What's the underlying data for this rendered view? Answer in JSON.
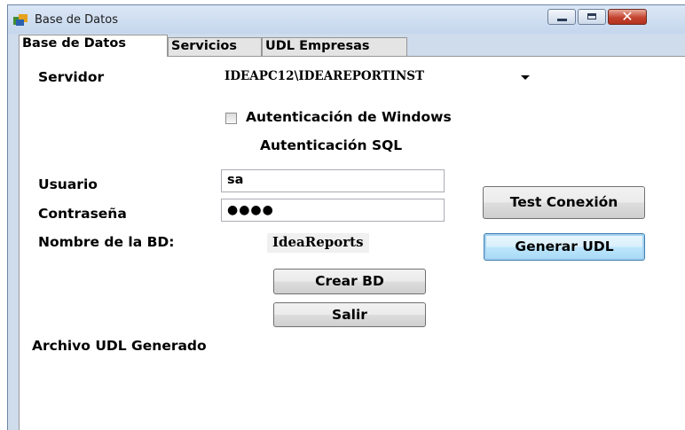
{
  "window": {
    "title": "Base de Datos",
    "close_glyph": "✕"
  },
  "tabs": [
    {
      "label": "Base de Datos",
      "active": true
    },
    {
      "label": "Servicios",
      "active": false
    },
    {
      "label": "UDL Empresas",
      "active": false
    }
  ],
  "form": {
    "servidor_label": "Servidor",
    "servidor_value": "IDEAPC12\\IDEAREPORTINST",
    "windows_auth_label": "Autenticación de Windows",
    "windows_auth_checked": false,
    "sql_auth_label": "Autenticación SQL",
    "usuario_label": "Usuario",
    "usuario_value": "sa",
    "password_label": "Contraseña",
    "password_value": "●●●●",
    "dbname_label": "Nombre de la BD:",
    "dbname_value": "IdeaReports",
    "udl_generated_label": "Archivo UDL Generado"
  },
  "buttons": {
    "test_connection": "Test Conexión",
    "generate_udl": "Generar UDL",
    "create_db": "Crear BD",
    "exit": "Salir"
  },
  "icons": {
    "app": "database-app-icon",
    "minimize": "minimize-icon",
    "maximize": "maximize-icon",
    "close": "close-icon",
    "dropdown": "chevron-down-icon"
  }
}
